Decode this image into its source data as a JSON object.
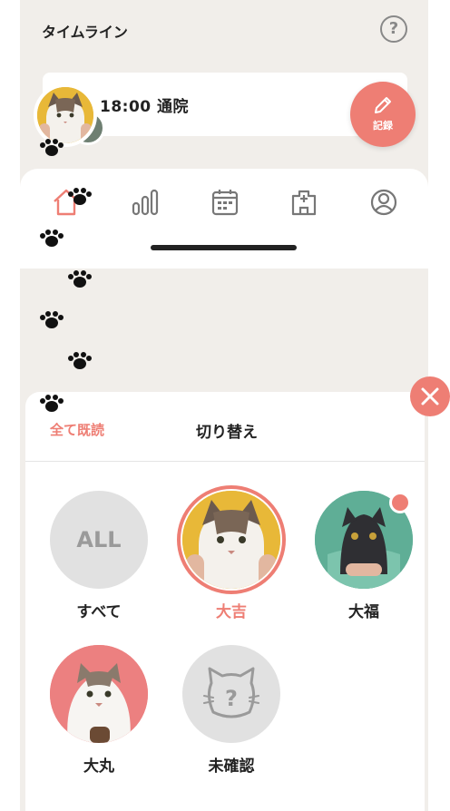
{
  "header": {
    "title": "タイムライン"
  },
  "timeline_event": {
    "time_label": "18:00  通院"
  },
  "record_button": {
    "label": "記録"
  },
  "nav": {
    "items": [
      "home-icon",
      "chart-icon",
      "calendar-icon",
      "hospital-icon",
      "profile-icon"
    ],
    "active": "home-icon"
  },
  "switcher": {
    "mark_all_read": "全て既読",
    "title": "切り替え",
    "pets": [
      {
        "name": "すべて",
        "avatar_text": "ALL",
        "selected": false
      },
      {
        "name": "大吉",
        "selected": true
      },
      {
        "name": "大福",
        "selected": false,
        "unread": true
      },
      {
        "name": "大丸",
        "selected": false
      },
      {
        "name": "未確認",
        "selected": false
      }
    ]
  },
  "colors": {
    "accent": "#ee7e74",
    "background": "#f1eeea",
    "placeholder": "#e1e1e1"
  }
}
